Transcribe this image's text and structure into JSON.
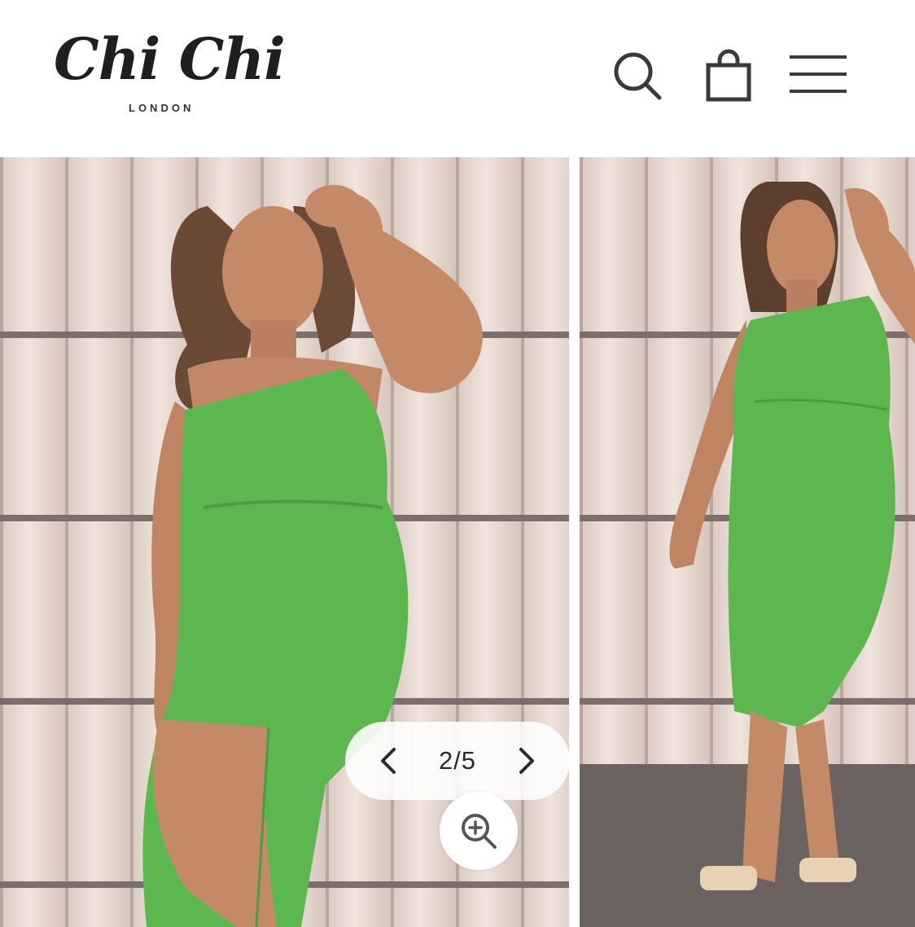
{
  "header": {
    "brand": "Chi Chi",
    "brand_sub": "LONDON",
    "icons": [
      "search-icon",
      "shopping-bag-icon",
      "hamburger-menu-icon"
    ]
  },
  "gallery": {
    "current": "2/5",
    "prev_icon": "chevron-left-icon",
    "next_icon": "chevron-right-icon",
    "zoom_icon": "zoom-in-icon"
  },
  "colors": {
    "dress": "#5cb84e",
    "wall": "#e6d8d0",
    "text": "#222222"
  }
}
